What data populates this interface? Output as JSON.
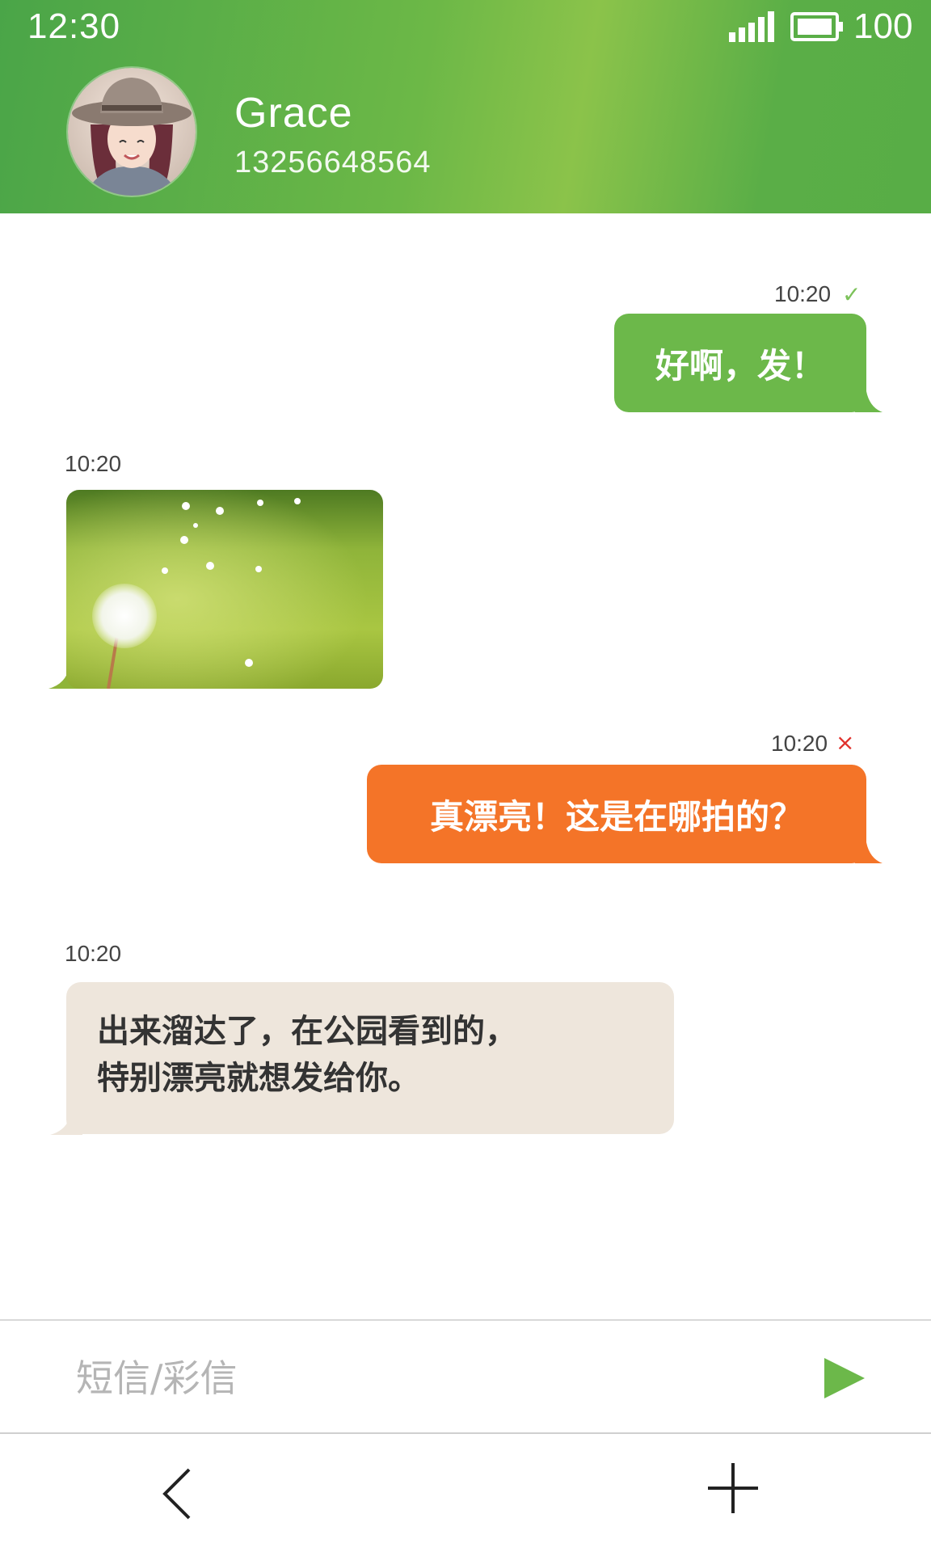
{
  "status_bar": {
    "time": "12:30",
    "battery_level": "100",
    "signal_icon": "signal-bars-icon",
    "battery_icon": "battery-icon"
  },
  "contact": {
    "name": "Grace",
    "phone": "13256648564"
  },
  "messages": [
    {
      "direction": "outgoing",
      "time": "10:20",
      "status": "sent",
      "status_mark": "✓",
      "text": "好啊，发！"
    },
    {
      "direction": "incoming",
      "time": "10:20",
      "type": "image",
      "image_subject": "dandelion"
    },
    {
      "direction": "outgoing",
      "time": "10:20",
      "status": "failed",
      "status_mark": "×",
      "text": "真漂亮！这是在哪拍的？"
    },
    {
      "direction": "incoming",
      "time": "10:20",
      "text_lines": [
        "出来溜达了，在公园看到的，",
        "特别漂亮就想发给你。"
      ]
    }
  ],
  "composer": {
    "placeholder": "短信/彩信",
    "value": "",
    "send_icon": "send-icon"
  },
  "nav": {
    "back_icon": "back-chevron-icon",
    "add_icon": "plus-icon"
  },
  "colors": {
    "header_green": "#5cae47",
    "outgoing_green": "#6cb84a",
    "outgoing_failed": "#f47428",
    "incoming_bubble": "#eee6dc",
    "sent_check": "#7cc25a",
    "failed_x": "#e0312c"
  }
}
